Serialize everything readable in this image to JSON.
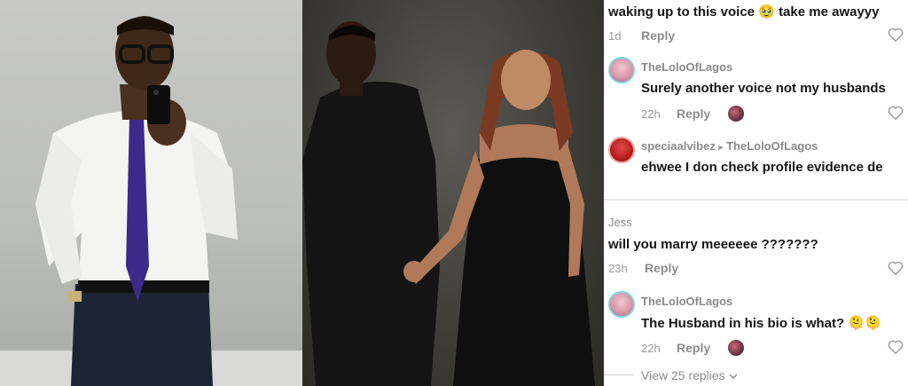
{
  "comments": [
    {
      "text": "waking up to this voice",
      "emoji": "🥹",
      "text_after": "take me awayyy",
      "age": "1d",
      "reply_label": "Reply"
    },
    {
      "username": "TheLoloOfLagos",
      "text": "Surely another voice not my husbands",
      "age": "22h",
      "reply_label": "Reply"
    },
    {
      "username": "speciaalvibez",
      "reply_to": "TheLoloOfLagos",
      "text": "ehwee I don check profile evidence de"
    },
    {
      "username": "Jess",
      "text": "will you marry meeeeee ???????",
      "age": "23h",
      "reply_label": "Reply"
    },
    {
      "username": "TheLoloOfLagos",
      "text": "The Husband in his bio is what?",
      "emoji": "🫠🫠",
      "age": "22h",
      "reply_label": "Reply",
      "view_replies": "View 25 replies"
    }
  ],
  "icons": {
    "heart": "heart-outline-icon",
    "separator": "▸",
    "chevron": "chevron-down-icon"
  },
  "colors": {
    "avatar_ring": "#7fd4e6",
    "muted_text": "#8d8d8d"
  }
}
